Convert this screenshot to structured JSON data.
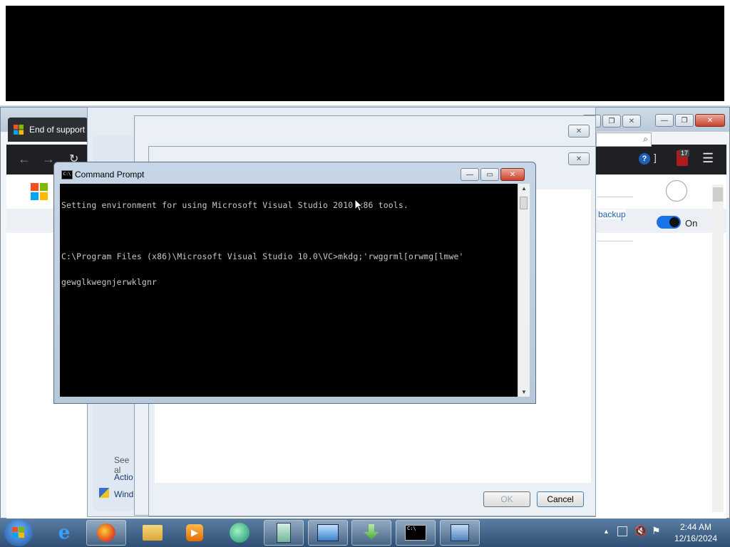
{
  "firefox": {
    "tab_label": "End of support",
    "backup_link": "backup",
    "toggle_label": "On",
    "badge_count": "17"
  },
  "control_panel": {
    "see_also": "See al",
    "action_item": "Actio",
    "windows_item": "Wind",
    "ok_label": "OK",
    "cancel_label": "Cancel"
  },
  "cmd": {
    "title": "Command Prompt",
    "line1": "Setting environment for using Microsoft Visual Studio 2010 x86 tools.",
    "line2": "C:\\Program Files (x86)\\Microsoft Visual Studio 10.0\\VC>mkdg;'rwggrml[orwmg[lmwe'",
    "line3": "gewglkwegnjerwklgnr",
    "icon_text": "C:\\"
  },
  "taskbar": {
    "time": "2:44 AM",
    "date": "12/16/2024",
    "items": [
      "start",
      "internet-explorer",
      "firefox",
      "file-explorer",
      "media-player",
      "app-swirl",
      "notepad-like",
      "control-panel",
      "download-manager",
      "command-prompt",
      "network-search"
    ]
  },
  "colors": {
    "taskbar": "#2e4f73",
    "cmd_bg": "#000000",
    "cmd_text": "#c8c8c8",
    "toggle_blue": "#1a73e8"
  }
}
